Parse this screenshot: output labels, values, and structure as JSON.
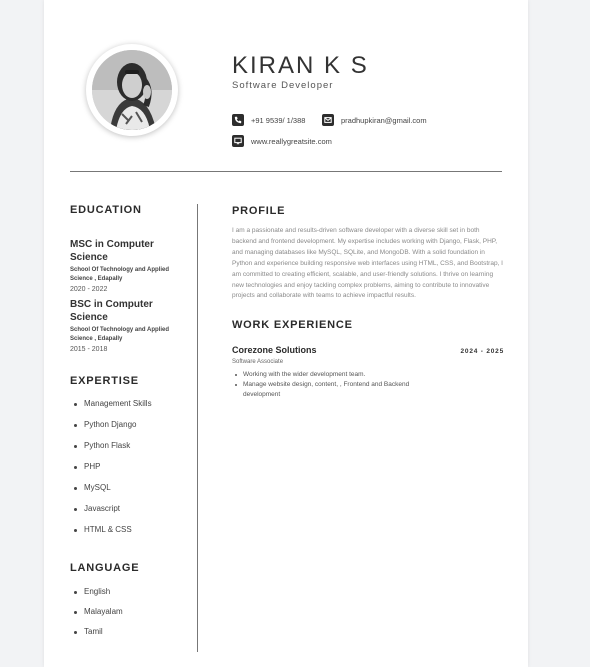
{
  "header": {
    "name": "KIRAN K S",
    "role": "Software Developer",
    "phone": "+91 9539/ 1/388",
    "email": "pradhupkiran@gmail.com",
    "website": "www.reallygreatsite.com"
  },
  "education": {
    "title": "EDUCATION",
    "entries": [
      {
        "degree": "MSC in Computer Science",
        "school": "School Of Technology and Applied Science , Edapally",
        "years": "2020 - 2022"
      },
      {
        "degree": "BSC in Computer Science",
        "school": "School Of Technology and Applied Science , Edapally",
        "years": "2015 - 2018"
      }
    ]
  },
  "expertise": {
    "title": "EXPERTISE",
    "items": [
      "Management Skills",
      "Python Django",
      "Python Flask",
      "PHP",
      "MySQL",
      "Javascript",
      "HTML & CSS"
    ]
  },
  "language": {
    "title": "LANGUAGE",
    "items": [
      "English",
      "Malayalam",
      "Tamil"
    ]
  },
  "profile": {
    "title": "PROFILE",
    "text": "I am a passionate and results-driven software developer with a diverse skill set in both backend and frontend development. My expertise includes working with Django, Flask, PHP, and managing databases like MySQL, SQLite, and MongoDB. With a solid foundation in Python and experience building responsive web interfaces using HTML, CSS, and Bootstrap, I am committed to creating efficient, scalable, and user-friendly solutions. I thrive on learning new technologies and enjoy tackling complex problems, aiming to contribute to innovative projects and collaborate with teams to achieve impactful results."
  },
  "work": {
    "title": "WORK EXPERIENCE",
    "jobs": [
      {
        "company": "Corezone Solutions",
        "years": "2024 - 2025",
        "position": "Software Associate",
        "tasks": [
          "Working with the wider development team.",
          "Manage website design, content, , Frontend and Backend development"
        ]
      }
    ]
  },
  "icons": {
    "phone": "phone-icon",
    "email": "mail-icon",
    "website": "web-icon"
  }
}
